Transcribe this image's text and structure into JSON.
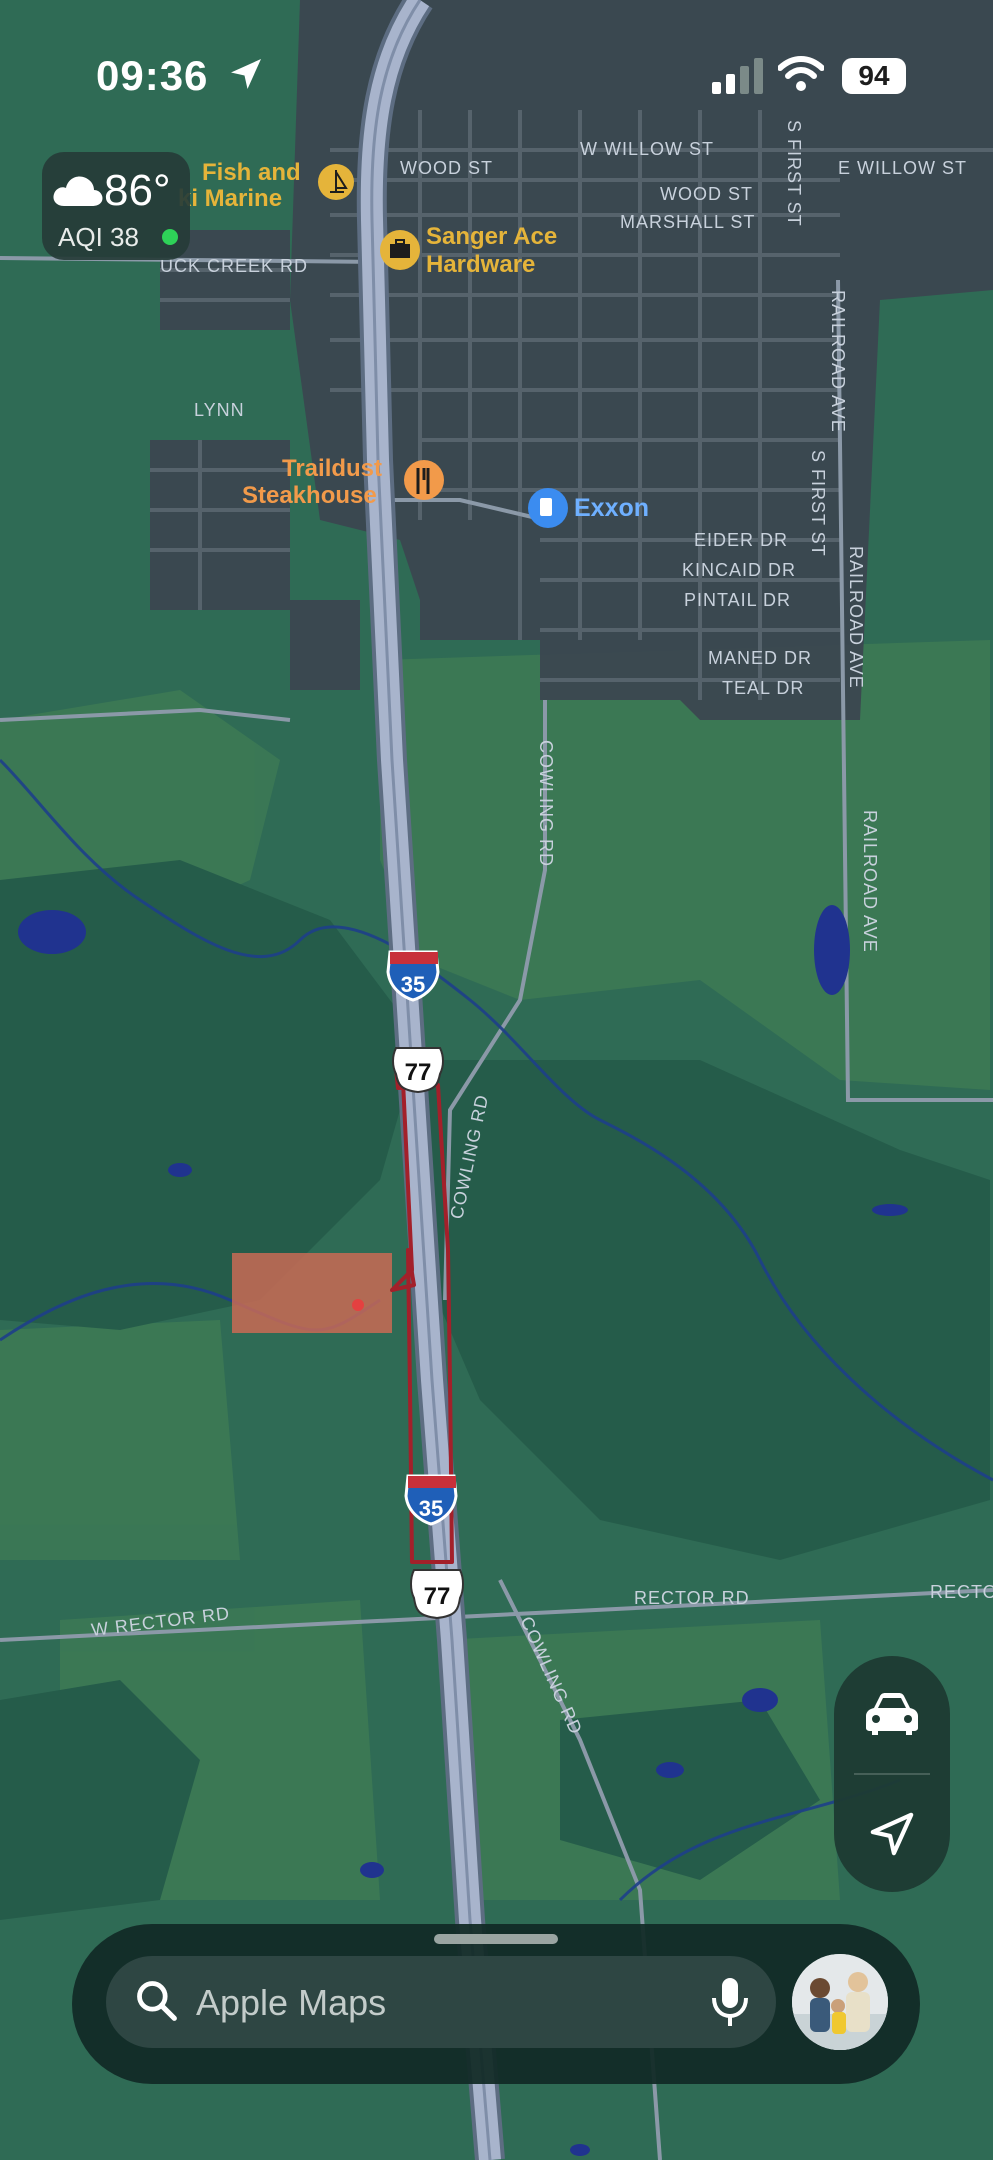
{
  "status_bar": {
    "time": "09:36",
    "battery": "94",
    "icons": [
      "location-arrow-icon",
      "signal-icon",
      "wifi-icon"
    ]
  },
  "weather": {
    "temperature": "86°",
    "aqi": "AQI 38",
    "icon": "cloud-icon",
    "aqi_color": "#2ed158"
  },
  "map": {
    "pois": [
      {
        "name": "Fish and Ski Marine",
        "line1": "Fish and",
        "line2": "ki Marine",
        "category": "marina",
        "color": "#e5b43a"
      },
      {
        "name": "Sanger Ace Hardware",
        "line1": "Sanger Ace",
        "line2": "Hardware",
        "category": "hardware",
        "color": "#e5b43a"
      },
      {
        "name": "Traildust Steakhouse",
        "line1": "Traildust",
        "line2": "Steakhouse",
        "category": "restaurant",
        "color": "#f29a4a"
      },
      {
        "name": "Exxon",
        "line1": "Exxon",
        "line2": "",
        "category": "gas-station",
        "color": "#3b8cf0"
      }
    ],
    "street_labels": {
      "w_willow_st": "W WILLOW ST",
      "e_willow_st": "E WILLOW ST",
      "wood_st_west": "WOOD ST",
      "wood_st_east": "WOOD ST",
      "marshall_st": "MARSHALL ST",
      "duck_creek_rd": "UCK CREEK RD",
      "lynn": "LYNN",
      "s_first_st_north": "S FIRST ST",
      "s_first_st_south": "S FIRST ST",
      "railroad_ave_north": "RAILROAD AVE",
      "railroad_ave_mid": "RAILROAD AVE",
      "railroad_ave_south": "RAILROAD AVE",
      "eider_dr": "EIDER DR",
      "kincaid_dr": "KINCAID DR",
      "pintail_dr": "PINTAIL DR",
      "maned_dr": "MANED DR",
      "teal_dr": "TEAL DR",
      "cowling_rd_north": "COWLING RD",
      "cowling_rd_mid": "COWLING RD",
      "cowling_rd_south": "COWLING RD",
      "w_rector_rd": "W RECTOR RD",
      "rector_rd_mid": "RECTOR RD",
      "rector_rd_east": "RECTO"
    },
    "shields": {
      "i35_north": "35",
      "us77_north": "77",
      "i35_south": "35",
      "us77_south": "77"
    },
    "annotation_color": "#a3202a",
    "highlight_color": "#c96a55"
  },
  "controls": {
    "drive_icon": "car-icon",
    "locate_icon": "location-arrow-icon"
  },
  "search": {
    "placeholder": "Apple Maps",
    "search_icon": "magnifying-glass-icon",
    "mic_icon": "microphone-icon"
  }
}
